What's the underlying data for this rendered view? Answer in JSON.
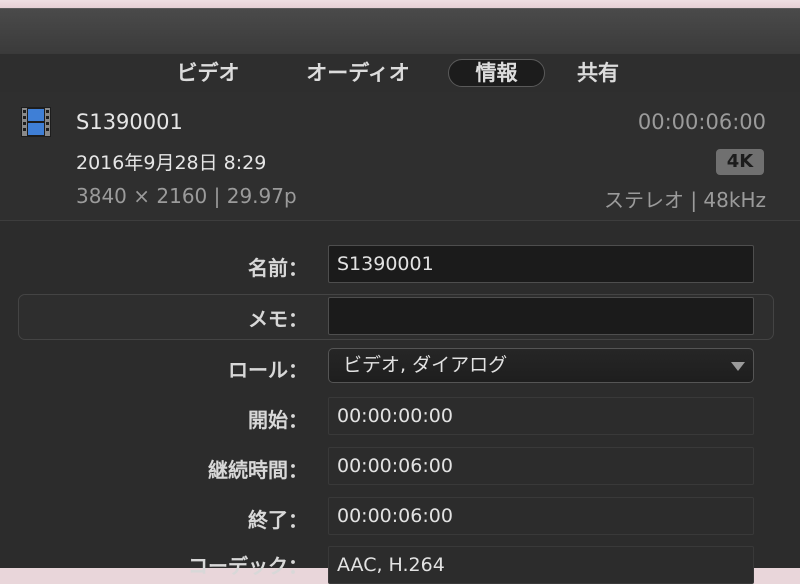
{
  "tabs": [
    {
      "label": "ビデオ",
      "active": false
    },
    {
      "label": "オーディオ",
      "active": false
    },
    {
      "label": "情報",
      "active": true
    },
    {
      "label": "共有",
      "active": false
    }
  ],
  "clip": {
    "name": "S1390001",
    "duration": "00:00:06:00",
    "date": "2016年9月28日 8:29",
    "badge": "4K",
    "resolution": "3840 × 2160  |  29.97p",
    "audio": "ステレオ  |  48kHz",
    "icon": "film-clip-icon"
  },
  "fields": {
    "name": {
      "label": "名前：",
      "value": "S1390001"
    },
    "memo": {
      "label": "メモ：",
      "value": ""
    },
    "role": {
      "label": "ロール：",
      "value": "ビデオ, ダイアログ"
    },
    "start": {
      "label": "開始：",
      "value": "00:00:00:00"
    },
    "duration": {
      "label": "継続時間：",
      "value": "00:00:06:00"
    },
    "end": {
      "label": "終了：",
      "value": "00:00:06:00"
    },
    "codec": {
      "label": "コーデック：",
      "value": "AAC, H.264"
    }
  },
  "colors": {
    "panel": "#303030",
    "text": "#dcdcdc",
    "dim": "#9b9b9b"
  }
}
